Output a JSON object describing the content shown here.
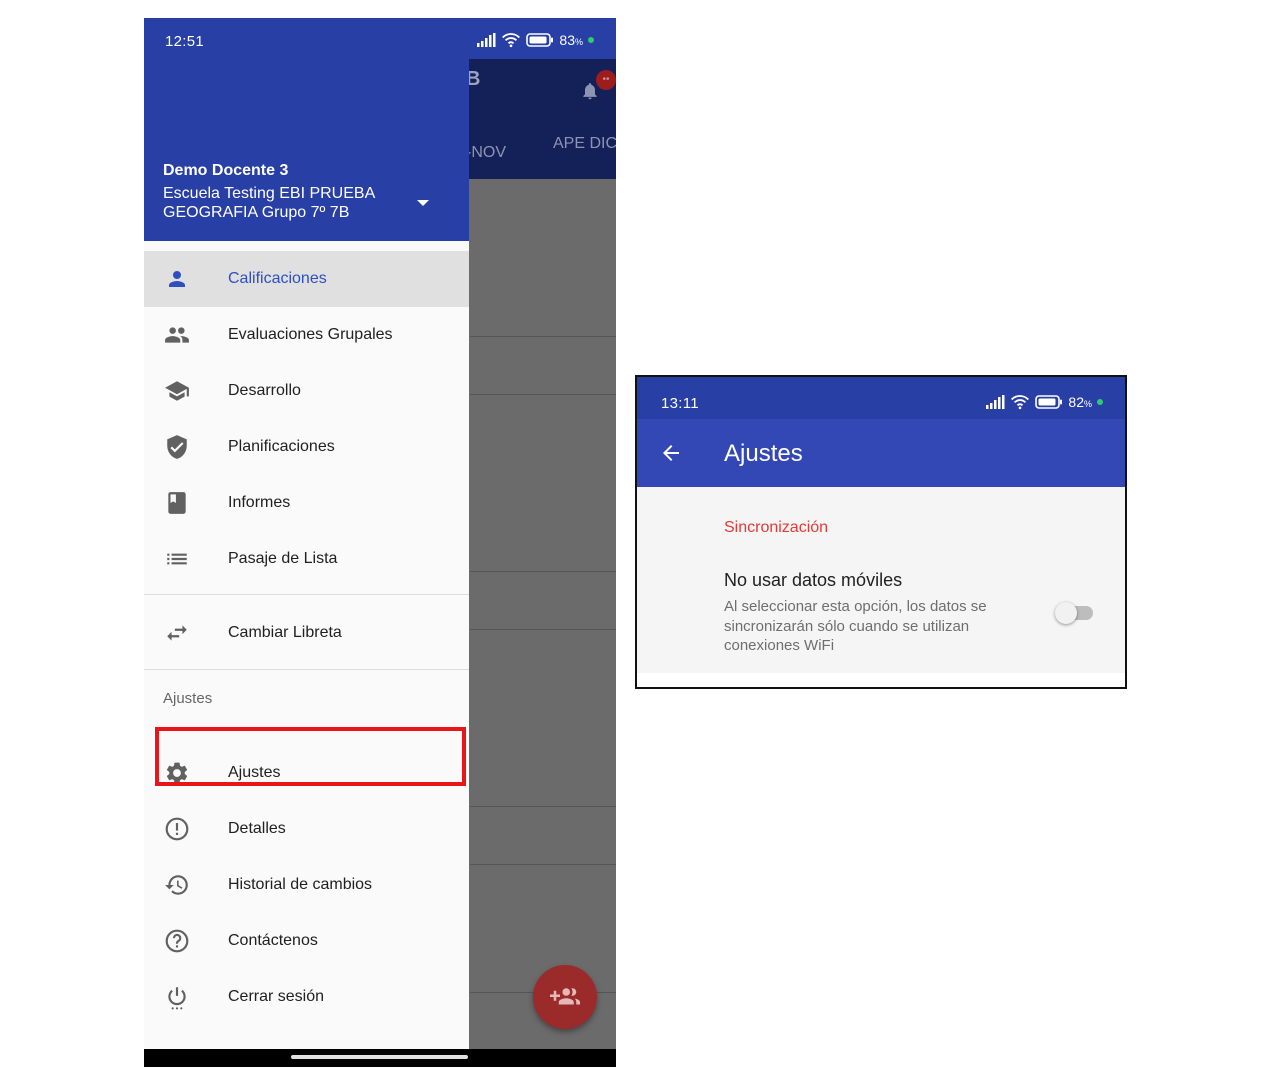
{
  "left_screen": {
    "status_bar": {
      "time": "12:51",
      "battery": "83",
      "battery_unit": "%"
    },
    "background_app": {
      "title_fragment": "B",
      "tab_1": "-NOV",
      "tab_2": "APE DIC"
    },
    "drawer_header": {
      "name": "Demo Docente 3",
      "school": "Escuela Testing EBI PRUEBA",
      "group": "GEOGRAFIA Grupo 7º 7B"
    },
    "menu": [
      {
        "label": "Calificaciones",
        "icon": "person-icon",
        "active": true
      },
      {
        "label": "Evaluaciones Grupales",
        "icon": "group-icon"
      },
      {
        "label": "Desarrollo",
        "icon": "school-icon"
      },
      {
        "label": "Planificaciones",
        "icon": "verified-icon"
      },
      {
        "label": "Informes",
        "icon": "book-icon"
      },
      {
        "label": "Pasaje de Lista",
        "icon": "list-icon"
      }
    ],
    "switch_notebook": {
      "label": "Cambiar Libreta",
      "icon": "swap-icon"
    },
    "settings_section": {
      "header": "Ajustes",
      "items": [
        {
          "label": "Ajustes",
          "icon": "gear-icon",
          "highlighted": true
        },
        {
          "label": "Detalles",
          "icon": "info-icon"
        },
        {
          "label": "Historial de cambios",
          "icon": "history-icon"
        },
        {
          "label": "Contáctenos",
          "icon": "help-icon"
        },
        {
          "label": "Cerrar sesión",
          "icon": "power-icon"
        }
      ]
    },
    "colors": {
      "primary": "#283fa6",
      "accent": "#2f4ec2",
      "highlight": "#e8161b",
      "fab": "#9b2a2a"
    }
  },
  "right_screen": {
    "status_bar": {
      "time": "13:11",
      "battery": "82",
      "battery_unit": "%"
    },
    "appbar": {
      "title": "Ajustes"
    },
    "section": "Sincronización",
    "preference": {
      "title": "No usar datos móviles",
      "summary": "Al seleccionar esta opción, los datos se sincronizarán sólo cuando se utilizan conexiones WiFi",
      "enabled": false
    },
    "colors": {
      "primary": "#3348b5",
      "section_title": "#e53935"
    }
  }
}
